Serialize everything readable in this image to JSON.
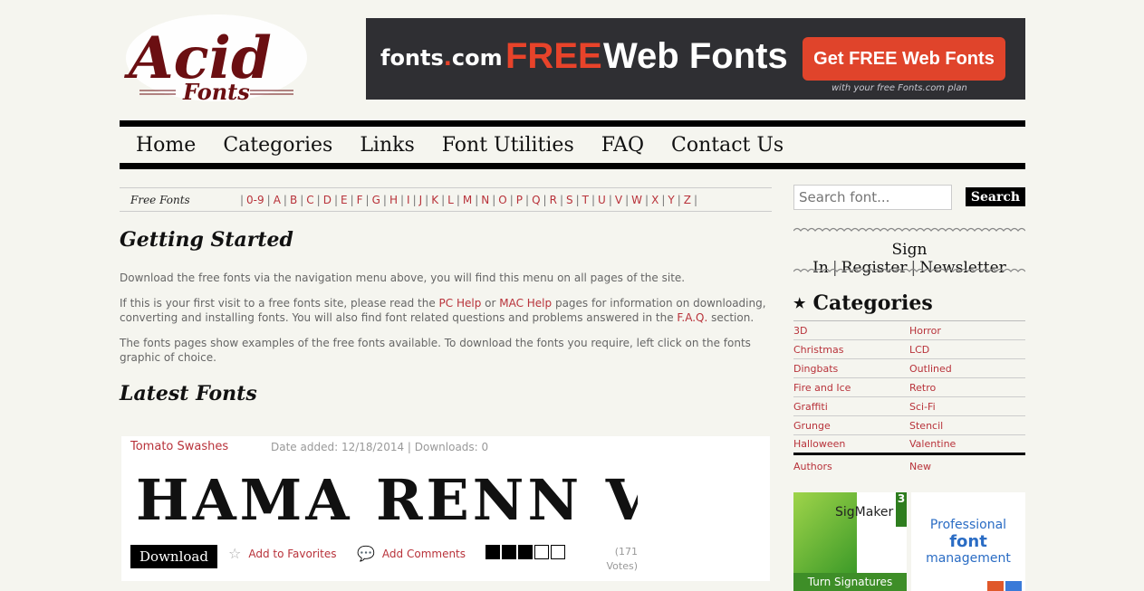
{
  "logo": {
    "word1": "Acid",
    "word2": "Fonts"
  },
  "banner": {
    "brand": "fonts",
    "brand_dot": ".",
    "brand_tld": "com",
    "free": "FREE",
    "web_fonts": "Web Fonts",
    "button": "Get FREE Web Fonts",
    "sub": "with your free Fonts.com plan"
  },
  "nav": {
    "items": [
      "Home",
      "Categories",
      "Links",
      "Font Utilities",
      "FAQ",
      "Contact Us"
    ]
  },
  "alpha": {
    "label": "Free Fonts",
    "letters": [
      "0-9",
      "A",
      "B",
      "C",
      "D",
      "E",
      "F",
      "G",
      "H",
      "I",
      "J",
      "K",
      "L",
      "M",
      "N",
      "O",
      "P",
      "Q",
      "R",
      "S",
      "T",
      "U",
      "V",
      "W",
      "X",
      "Y",
      "Z"
    ]
  },
  "main": {
    "getting_started": "Getting Started",
    "p1": "Download the free fonts via the navigation menu above, you will find this menu on all pages of the site.",
    "p2_a": "If this is your first visit to a free fonts site, please read the ",
    "p2_link1": "PC Help",
    "p2_b": " or ",
    "p2_link2": "MAC Help",
    "p2_c": " pages for information on downloading, converting and installing fonts. You will also find font related questions and problems answered in the ",
    "p2_link3": "F.A.Q.",
    "p2_d": " section.",
    "p3": "The fonts pages show examples of the free fonts available. To download the fonts you require, left click on the fonts graphic of choice.",
    "latest_fonts": "Latest Fonts"
  },
  "font_card": {
    "name": "Tomato Swashes",
    "meta": "Date added: 12/18/2014  |  Downloads: 0",
    "preview_text": "HAMA RENN V",
    "download": "Download",
    "favorites": "Add to Favorites",
    "comments": "Add Comments",
    "rating": 3,
    "rating_max": 5,
    "votes": "(171 Votes)"
  },
  "sidebar": {
    "search_placeholder": "Search font...",
    "search_button": "Search",
    "sign_in": "Sign In",
    "register": "Register",
    "newsletter": "Newsletter",
    "categories_title": "Categories",
    "categories": [
      [
        "3D",
        "Horror"
      ],
      [
        "Christmas",
        "LCD"
      ],
      [
        "Dingbats",
        "Outlined"
      ],
      [
        "Fire and Ice",
        "Retro"
      ],
      [
        "Graffiti",
        "Sci-Fi"
      ],
      [
        "Grunge",
        "Stencil"
      ],
      [
        "Halloween",
        "Valentine"
      ]
    ],
    "extra": [
      "Authors",
      "New"
    ],
    "ad1": {
      "title": "SigMaker",
      "num": "3",
      "footer": "Turn Signatures"
    },
    "ad2": {
      "l1": "Professional",
      "l2": "font",
      "l3": "management"
    }
  },
  "colors": {
    "accent": "#b8323a",
    "banner_bg": "#2f2f33",
    "banner_red": "#e8432a",
    "logo": "#6b0f12"
  }
}
